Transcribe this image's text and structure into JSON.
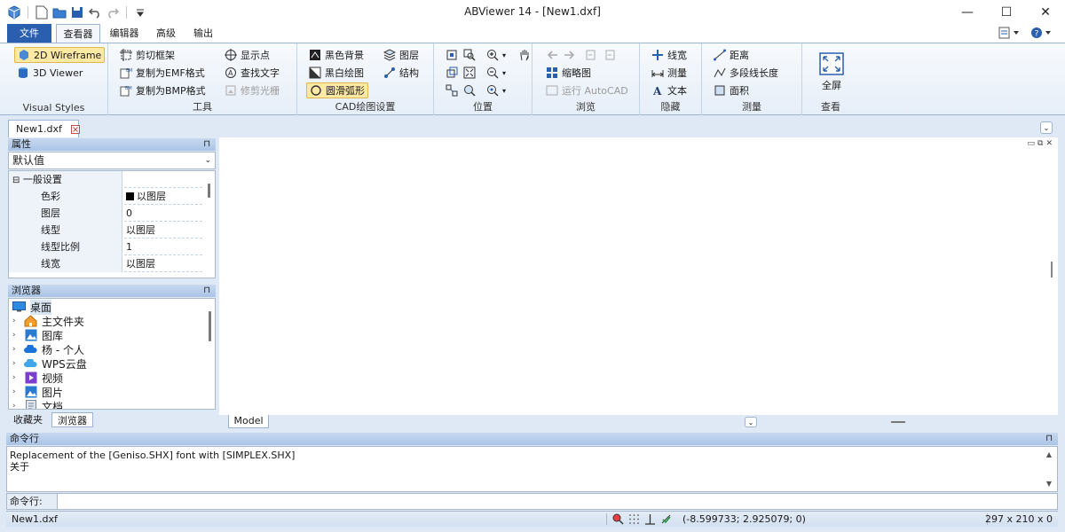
{
  "window": {
    "title": "ABViewer 14 - [New1.dxf]",
    "minimize": "—",
    "maximize": "☐",
    "close": "✕"
  },
  "tabs": {
    "file": "文件",
    "viewer": "查看器",
    "editor": "编辑器",
    "advanced": "高级",
    "output": "输出"
  },
  "ribbon": {
    "visual_styles": {
      "label": "Visual Styles",
      "wireframe": "2D Wireframe",
      "viewer3d": "3D Viewer"
    },
    "tools": {
      "label": "工具",
      "clip_frame": "剪切框架",
      "copy_emf": "复制为EMF格式",
      "copy_bmp": "复制为BMP格式",
      "show_points": "显示点",
      "find_text": "查找文字",
      "trim_raster": "修剪光栅"
    },
    "cad_settings": {
      "label": "CAD绘图设置",
      "black_bg": "黑色背景",
      "black_white": "黑白绘图",
      "smooth_arcs": "圆滑弧形",
      "layers": "图层",
      "structure": "结构"
    },
    "position": {
      "label": "位置"
    },
    "browse": {
      "label": "浏览",
      "thumbnails": "缩略图",
      "run_autocad": "运行 AutoCAD"
    },
    "hide": {
      "label": "隐藏",
      "lineweight": "线宽",
      "measure": "测量",
      "text": "文本"
    },
    "measure": {
      "label": "测量",
      "distance": "距离",
      "polyline_length": "多段线长度",
      "area": "面积"
    },
    "view": {
      "label": "查看",
      "fullscreen": "全屏"
    }
  },
  "document_tab": {
    "name": "New1.dxf"
  },
  "properties": {
    "title": "属性",
    "pin": "⊓",
    "selector": "默认值",
    "category": "一般设置",
    "rows": [
      {
        "key": "色彩",
        "value": "以图层"
      },
      {
        "key": "图层",
        "value": "0"
      },
      {
        "key": "线型",
        "value": "以图层"
      },
      {
        "key": "线型比例",
        "value": "1"
      },
      {
        "key": "线宽",
        "value": "以图层"
      }
    ]
  },
  "browser": {
    "title": "浏览器",
    "pin": "⊓",
    "root": "桌面",
    "items": [
      "主文件夹",
      "图库",
      "杨 - 个人",
      "WPS云盘",
      "视频",
      "图片",
      "文档"
    ],
    "tab_favorites": "收藏夹",
    "tab_browser": "浏览器"
  },
  "canvas": {
    "model_tab": "Model"
  },
  "command": {
    "title": "命令行",
    "pin": "⊓",
    "log": [
      "Replacement of the [Geniso.SHX] font with [SIMPLEX.SHX]",
      "关于"
    ],
    "prompt_label": "命令行:",
    "input_value": ""
  },
  "status": {
    "file": "New1.dxf",
    "coords": "(-8.599733; 2.925079; 0)",
    "size": "297 x 210 x 0"
  },
  "colors": {
    "accent": "#2a5fb0",
    "ribbon_bg": "#e6eef8",
    "selected_btn": "#fde8a4"
  }
}
